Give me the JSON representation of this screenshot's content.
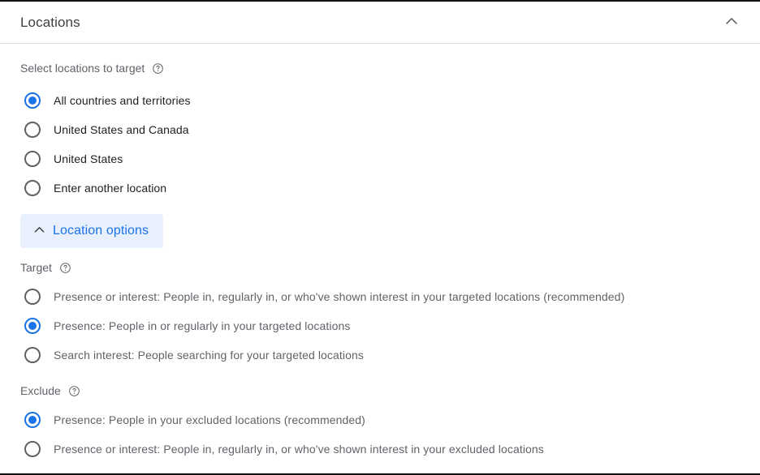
{
  "header": {
    "title": "Locations",
    "collapse_icon": "chevron-up-icon"
  },
  "target_selection": {
    "label": "Select locations to target",
    "help_icon": "help-circle-icon",
    "options": [
      {
        "label": "All countries and territories",
        "selected": true
      },
      {
        "label": "United States and Canada",
        "selected": false
      },
      {
        "label": "United States",
        "selected": false
      },
      {
        "label": "Enter another location",
        "selected": false
      }
    ]
  },
  "location_options_toggle": {
    "label": "Location options",
    "icon": "chevron-up-icon",
    "expanded": true,
    "background_color": "#e8f0fe",
    "text_color": "#1a73e8"
  },
  "target": {
    "label": "Target",
    "help_icon": "help-circle-icon",
    "options": [
      {
        "label": "Presence or interest: People in, regularly in, or who've shown interest in your targeted locations (recommended)",
        "selected": false
      },
      {
        "label": "Presence: People in or regularly in your targeted locations",
        "selected": true
      },
      {
        "label": "Search interest: People searching for your targeted locations",
        "selected": false
      }
    ]
  },
  "exclude": {
    "label": "Exclude",
    "help_icon": "help-circle-icon",
    "options": [
      {
        "label": "Presence: People in your excluded locations (recommended)",
        "selected": true
      },
      {
        "label": "Presence or interest: People in, regularly in, or who've shown interest in your excluded locations",
        "selected": false
      }
    ]
  },
  "colors": {
    "accent": "#1a73e8",
    "text_primary": "#202124",
    "text_secondary": "#5f6368",
    "divider": "#e0e0e0"
  }
}
